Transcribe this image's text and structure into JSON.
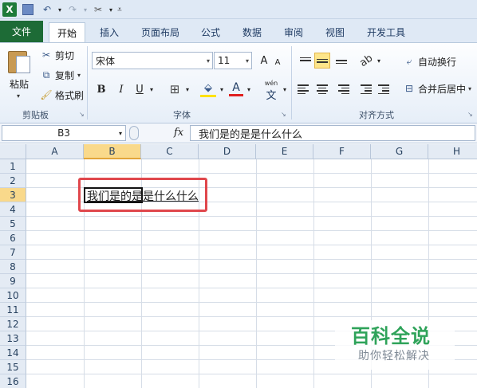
{
  "quick_access": {
    "app_icon": "excel-logo",
    "app_letter": "X",
    "icons": [
      "save-icon",
      "undo-icon",
      "redo-icon",
      "tools-icon",
      "customize-icon"
    ]
  },
  "tabs": [
    "文件",
    "开始",
    "插入",
    "页面布局",
    "公式",
    "数据",
    "审阅",
    "视图",
    "开发工具"
  ],
  "active_tab": "开始",
  "clipboard": {
    "paste_label": "粘贴",
    "cut_label": "剪切",
    "copy_label": "复制",
    "format_painter_label": "格式刷",
    "group_label": "剪贴板"
  },
  "font": {
    "font_name": "宋体",
    "font_size": "11",
    "bold": "B",
    "italic": "I",
    "underline": "U",
    "grow_icon": "A",
    "shrink_icon": "A",
    "color_icon": "A",
    "phonetic": "wén",
    "phonetic_char": "文",
    "group_label": "字体"
  },
  "alignment": {
    "wrap_label": "自动换行",
    "merge_label": "合并后居中",
    "group_label": "对齐方式"
  },
  "formula_bar": {
    "name_box": "B3",
    "fx": "fx",
    "value": "我们是的是是什么什么"
  },
  "sheet": {
    "columns": [
      "A",
      "B",
      "C",
      "D",
      "E",
      "F",
      "G",
      "H"
    ],
    "rows": [
      "1",
      "2",
      "3",
      "4",
      "5",
      "6",
      "7",
      "8",
      "9",
      "10",
      "11",
      "12",
      "13",
      "14",
      "15",
      "16"
    ],
    "selected_cell": "B3",
    "selected_column": "B",
    "selected_row": "3",
    "cell_b3_text": "我们是的是是什么什么"
  },
  "watermark": {
    "title": "百科全说",
    "subtitle": "助你轻松解决"
  },
  "colors": {
    "file_tab": "#1d6b36",
    "highlight_box": "#e0474c",
    "selection_header": "#f9d98b",
    "watermark_green": "#2fa35a"
  }
}
